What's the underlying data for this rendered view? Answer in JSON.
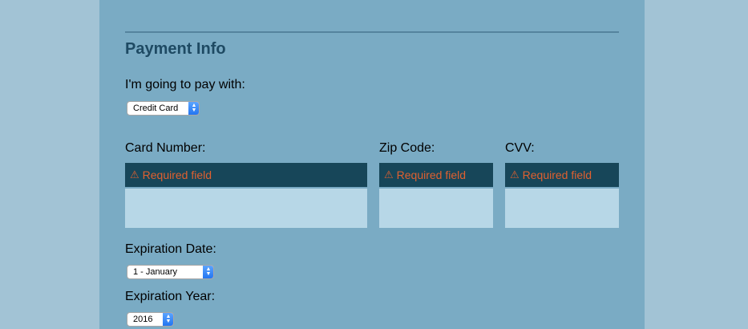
{
  "section": {
    "title": "Payment Info"
  },
  "payment": {
    "label": "I'm going to pay with:",
    "selected": "Credit Card"
  },
  "card_number": {
    "label": "Card Number:",
    "error": "Required field"
  },
  "zip_code": {
    "label": "Zip Code:",
    "error": "Required field"
  },
  "cvv": {
    "label": "CVV:",
    "error": "Required field"
  },
  "expiration_date": {
    "label": "Expiration Date:",
    "selected": "1 - January"
  },
  "expiration_year": {
    "label": "Expiration Year:",
    "selected": "2016"
  },
  "icons": {
    "warning": "warning-icon",
    "select_arrow": "chevron-updown-icon"
  },
  "colors": {
    "page_bg": "#a2c3d5",
    "panel_bg": "#7aabc4",
    "title": "#1e4a63",
    "error_bg": "#174659",
    "error_text": "#e0602f",
    "input_bg": "#b7d7e7"
  }
}
